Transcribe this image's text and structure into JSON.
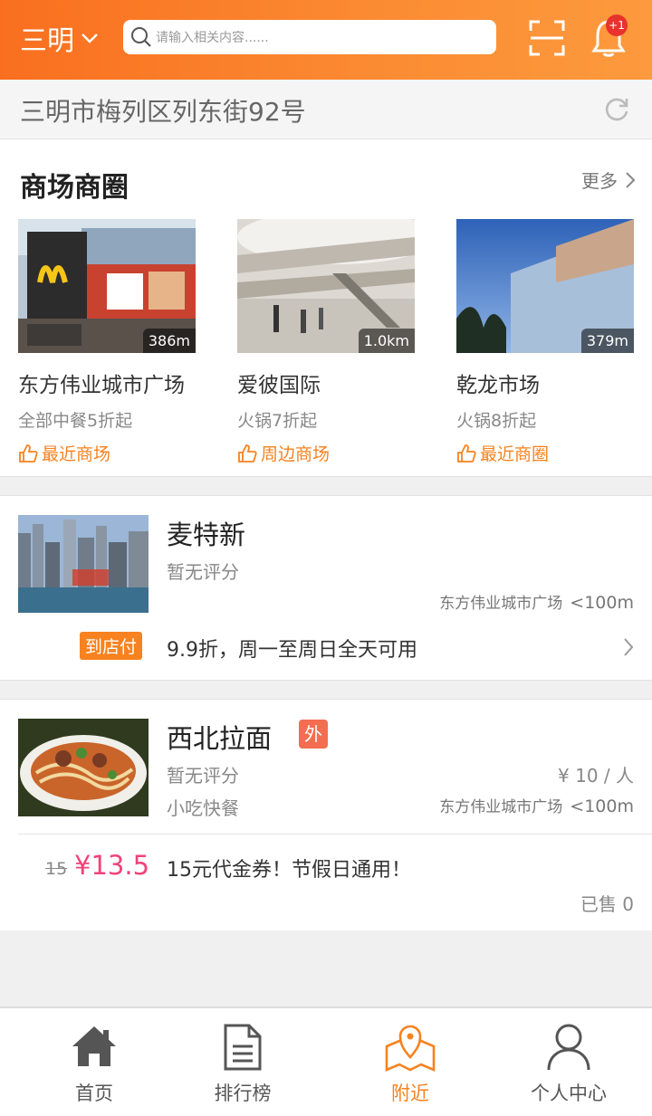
{
  "header": {
    "city": "三明",
    "search_placeholder": "请输入相关内容......",
    "notification_badge": "+1"
  },
  "location": {
    "address": "三明市梅列区列东街92号"
  },
  "malls_section": {
    "title": "商场商圈",
    "more_label": "更多",
    "items": [
      {
        "name": "东方伟业城市广场",
        "distance": "386m",
        "deal": "全部中餐5折起",
        "tag": "最近商场"
      },
      {
        "name": "爱彼国际",
        "distance": "1.0km",
        "deal": "火锅7折起",
        "tag": "周边商场"
      },
      {
        "name": "乾龙市场",
        "distance": "379m",
        "deal": "火锅8折起",
        "tag": "最近商圈"
      }
    ]
  },
  "shops": [
    {
      "name": "麦特新",
      "rating": "暂无评分",
      "mall": "东方伟业城市广场",
      "distance": "<100m",
      "pay_tag": "到店付",
      "deal": "9.9折，周一至周日全天可用"
    },
    {
      "name": "西北拉面",
      "badge": "外",
      "rating": "暂无评分",
      "category": "小吃快餐",
      "price_per_person": "¥ 10 / 人",
      "mall": "东方伟业城市广场",
      "distance": "<100m",
      "old_price": "15",
      "new_price": "¥13.5",
      "deal": "15元代金券！节假日通用！",
      "sold": "已售 0"
    }
  ],
  "tabbar": {
    "items": [
      {
        "label": "首页",
        "icon": "home-icon"
      },
      {
        "label": "排行榜",
        "icon": "document-icon"
      },
      {
        "label": "附近",
        "icon": "map-pin-icon"
      },
      {
        "label": "个人中心",
        "icon": "user-icon"
      }
    ],
    "active": "附近"
  },
  "colors": {
    "accent": "#f7821f",
    "price": "#f0427a",
    "header_start": "#f96f1f",
    "header_end": "#fd9a3d"
  }
}
